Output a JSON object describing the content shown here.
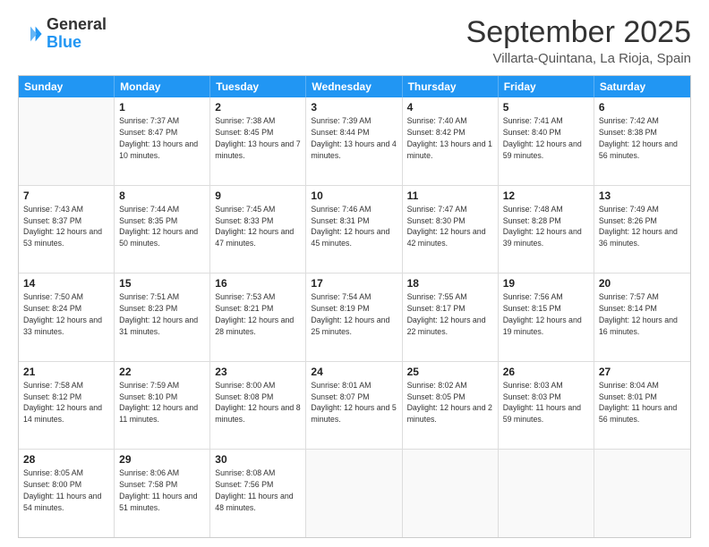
{
  "header": {
    "logo_line1": "General",
    "logo_line2": "Blue",
    "month": "September 2025",
    "location": "Villarta-Quintana, La Rioja, Spain"
  },
  "weekdays": [
    "Sunday",
    "Monday",
    "Tuesday",
    "Wednesday",
    "Thursday",
    "Friday",
    "Saturday"
  ],
  "rows": [
    [
      {
        "day": "",
        "sunrise": "",
        "sunset": "",
        "daylight": ""
      },
      {
        "day": "1",
        "sunrise": "Sunrise: 7:37 AM",
        "sunset": "Sunset: 8:47 PM",
        "daylight": "Daylight: 13 hours and 10 minutes."
      },
      {
        "day": "2",
        "sunrise": "Sunrise: 7:38 AM",
        "sunset": "Sunset: 8:45 PM",
        "daylight": "Daylight: 13 hours and 7 minutes."
      },
      {
        "day": "3",
        "sunrise": "Sunrise: 7:39 AM",
        "sunset": "Sunset: 8:44 PM",
        "daylight": "Daylight: 13 hours and 4 minutes."
      },
      {
        "day": "4",
        "sunrise": "Sunrise: 7:40 AM",
        "sunset": "Sunset: 8:42 PM",
        "daylight": "Daylight: 13 hours and 1 minute."
      },
      {
        "day": "5",
        "sunrise": "Sunrise: 7:41 AM",
        "sunset": "Sunset: 8:40 PM",
        "daylight": "Daylight: 12 hours and 59 minutes."
      },
      {
        "day": "6",
        "sunrise": "Sunrise: 7:42 AM",
        "sunset": "Sunset: 8:38 PM",
        "daylight": "Daylight: 12 hours and 56 minutes."
      }
    ],
    [
      {
        "day": "7",
        "sunrise": "Sunrise: 7:43 AM",
        "sunset": "Sunset: 8:37 PM",
        "daylight": "Daylight: 12 hours and 53 minutes."
      },
      {
        "day": "8",
        "sunrise": "Sunrise: 7:44 AM",
        "sunset": "Sunset: 8:35 PM",
        "daylight": "Daylight: 12 hours and 50 minutes."
      },
      {
        "day": "9",
        "sunrise": "Sunrise: 7:45 AM",
        "sunset": "Sunset: 8:33 PM",
        "daylight": "Daylight: 12 hours and 47 minutes."
      },
      {
        "day": "10",
        "sunrise": "Sunrise: 7:46 AM",
        "sunset": "Sunset: 8:31 PM",
        "daylight": "Daylight: 12 hours and 45 minutes."
      },
      {
        "day": "11",
        "sunrise": "Sunrise: 7:47 AM",
        "sunset": "Sunset: 8:30 PM",
        "daylight": "Daylight: 12 hours and 42 minutes."
      },
      {
        "day": "12",
        "sunrise": "Sunrise: 7:48 AM",
        "sunset": "Sunset: 8:28 PM",
        "daylight": "Daylight: 12 hours and 39 minutes."
      },
      {
        "day": "13",
        "sunrise": "Sunrise: 7:49 AM",
        "sunset": "Sunset: 8:26 PM",
        "daylight": "Daylight: 12 hours and 36 minutes."
      }
    ],
    [
      {
        "day": "14",
        "sunrise": "Sunrise: 7:50 AM",
        "sunset": "Sunset: 8:24 PM",
        "daylight": "Daylight: 12 hours and 33 minutes."
      },
      {
        "day": "15",
        "sunrise": "Sunrise: 7:51 AM",
        "sunset": "Sunset: 8:23 PM",
        "daylight": "Daylight: 12 hours and 31 minutes."
      },
      {
        "day": "16",
        "sunrise": "Sunrise: 7:53 AM",
        "sunset": "Sunset: 8:21 PM",
        "daylight": "Daylight: 12 hours and 28 minutes."
      },
      {
        "day": "17",
        "sunrise": "Sunrise: 7:54 AM",
        "sunset": "Sunset: 8:19 PM",
        "daylight": "Daylight: 12 hours and 25 minutes."
      },
      {
        "day": "18",
        "sunrise": "Sunrise: 7:55 AM",
        "sunset": "Sunset: 8:17 PM",
        "daylight": "Daylight: 12 hours and 22 minutes."
      },
      {
        "day": "19",
        "sunrise": "Sunrise: 7:56 AM",
        "sunset": "Sunset: 8:15 PM",
        "daylight": "Daylight: 12 hours and 19 minutes."
      },
      {
        "day": "20",
        "sunrise": "Sunrise: 7:57 AM",
        "sunset": "Sunset: 8:14 PM",
        "daylight": "Daylight: 12 hours and 16 minutes."
      }
    ],
    [
      {
        "day": "21",
        "sunrise": "Sunrise: 7:58 AM",
        "sunset": "Sunset: 8:12 PM",
        "daylight": "Daylight: 12 hours and 14 minutes."
      },
      {
        "day": "22",
        "sunrise": "Sunrise: 7:59 AM",
        "sunset": "Sunset: 8:10 PM",
        "daylight": "Daylight: 12 hours and 11 minutes."
      },
      {
        "day": "23",
        "sunrise": "Sunrise: 8:00 AM",
        "sunset": "Sunset: 8:08 PM",
        "daylight": "Daylight: 12 hours and 8 minutes."
      },
      {
        "day": "24",
        "sunrise": "Sunrise: 8:01 AM",
        "sunset": "Sunset: 8:07 PM",
        "daylight": "Daylight: 12 hours and 5 minutes."
      },
      {
        "day": "25",
        "sunrise": "Sunrise: 8:02 AM",
        "sunset": "Sunset: 8:05 PM",
        "daylight": "Daylight: 12 hours and 2 minutes."
      },
      {
        "day": "26",
        "sunrise": "Sunrise: 8:03 AM",
        "sunset": "Sunset: 8:03 PM",
        "daylight": "Daylight: 11 hours and 59 minutes."
      },
      {
        "day": "27",
        "sunrise": "Sunrise: 8:04 AM",
        "sunset": "Sunset: 8:01 PM",
        "daylight": "Daylight: 11 hours and 56 minutes."
      }
    ],
    [
      {
        "day": "28",
        "sunrise": "Sunrise: 8:05 AM",
        "sunset": "Sunset: 8:00 PM",
        "daylight": "Daylight: 11 hours and 54 minutes."
      },
      {
        "day": "29",
        "sunrise": "Sunrise: 8:06 AM",
        "sunset": "Sunset: 7:58 PM",
        "daylight": "Daylight: 11 hours and 51 minutes."
      },
      {
        "day": "30",
        "sunrise": "Sunrise: 8:08 AM",
        "sunset": "Sunset: 7:56 PM",
        "daylight": "Daylight: 11 hours and 48 minutes."
      },
      {
        "day": "",
        "sunrise": "",
        "sunset": "",
        "daylight": ""
      },
      {
        "day": "",
        "sunrise": "",
        "sunset": "",
        "daylight": ""
      },
      {
        "day": "",
        "sunrise": "",
        "sunset": "",
        "daylight": ""
      },
      {
        "day": "",
        "sunrise": "",
        "sunset": "",
        "daylight": ""
      }
    ]
  ]
}
